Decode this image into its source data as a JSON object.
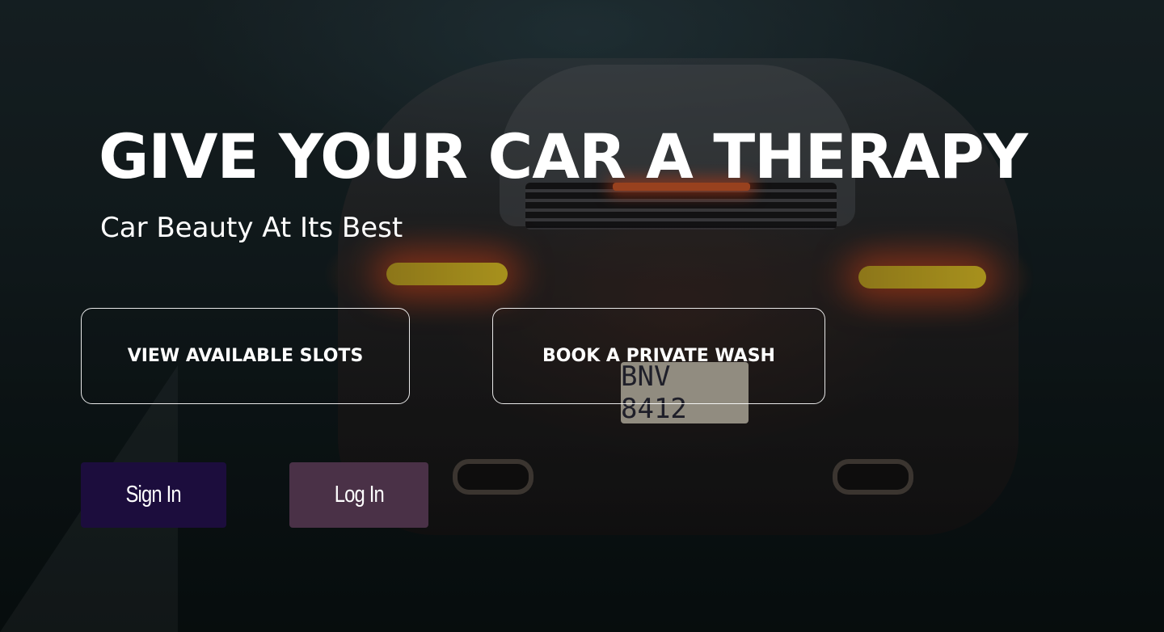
{
  "hero": {
    "title": "GIVE YOUR CAR A THERAPY",
    "subtitle": "Car Beauty At Its Best"
  },
  "actions": {
    "view_slots_label": "VIEW AVAILABLE SLOTS",
    "book_wash_label": "BOOK A PRIVATE WASH"
  },
  "auth": {
    "sign_in_label": "Sign In",
    "log_in_label": "Log In"
  },
  "background": {
    "plate_text": "BNV 8412"
  },
  "colors": {
    "sign_in_bg": "#1c0d3d",
    "log_in_bg": "#4a3147",
    "text": "#ffffff"
  }
}
